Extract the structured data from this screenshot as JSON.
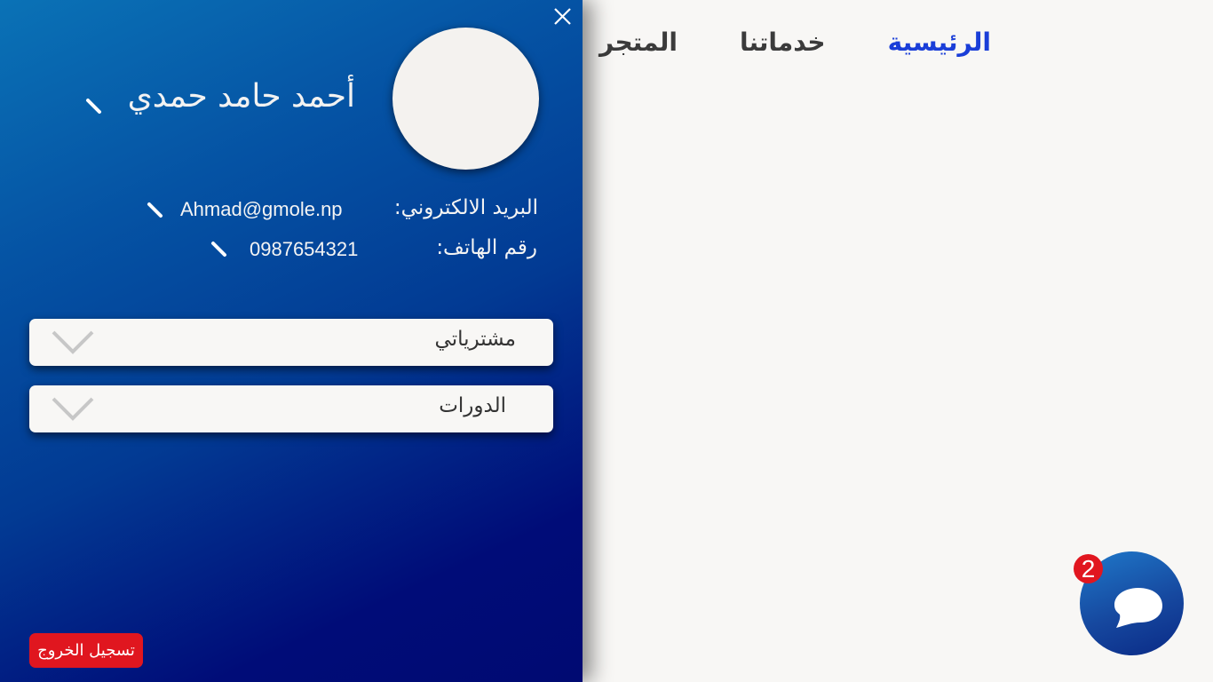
{
  "nav": {
    "items": [
      {
        "label": "الرئيسية",
        "active": true
      },
      {
        "label": "خدماتنا",
        "active": false
      },
      {
        "label": "المتجر",
        "active": false
      }
    ],
    "active_color": "#1a3ed8"
  },
  "drawer": {
    "user_name": "أحمد حامد حمدي",
    "email_label": "البريد الالكتروني:",
    "email_value": "Ahmad@gmole.np",
    "phone_label": "رقم الهاتف:",
    "phone_value": "0987654321",
    "sections": [
      {
        "label": "مشترياتي",
        "expanded": false
      },
      {
        "label": "الدورات",
        "expanded": false
      }
    ],
    "logout_label": "تسجيل الخروج",
    "gradient_colors": [
      "#0a72b6",
      "#000a72"
    ],
    "icons": [
      "close-icon",
      "edit-icon",
      "chevron-down-icon"
    ]
  },
  "chat": {
    "badge_count": "2",
    "icon": "chat-bubble-icon",
    "badge_color": "#e1161f"
  }
}
